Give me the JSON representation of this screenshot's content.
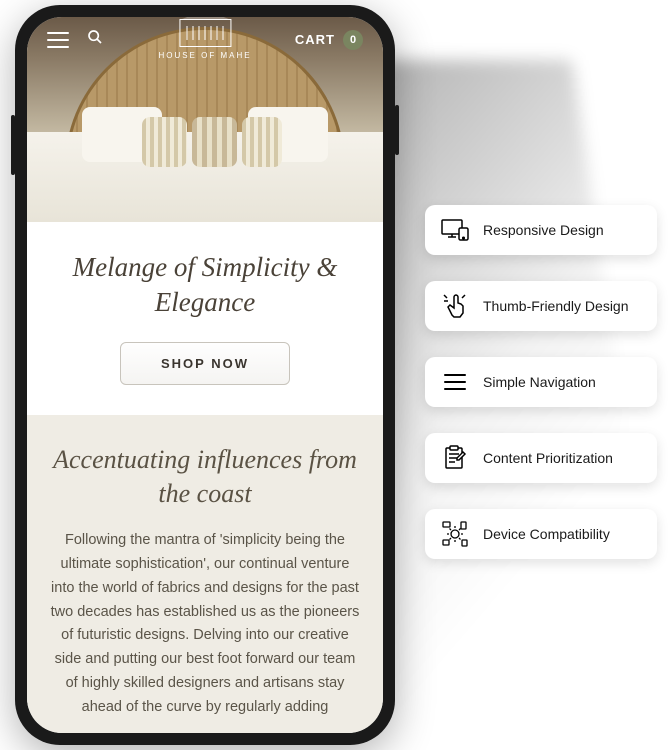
{
  "header": {
    "logo_text": "HOUSE OF MAHE",
    "cart_label": "CART",
    "cart_count": "0"
  },
  "hero": {
    "heading": "Melange of Simplicity & Elegance",
    "cta": "SHOP NOW"
  },
  "section2": {
    "heading": "Accentuating influences from the coast",
    "body": "Following the mantra of 'simplicity being the ultimate sophistication', our continual venture into the world of fabrics and designs for the past two decades has established us as the pioneers of futuristic designs. Delving into our creative side and putting our best foot forward our team of highly skilled designers and artisans stay ahead of the curve by regularly adding"
  },
  "features": [
    {
      "label": "Responsive Design",
      "icon": "devices"
    },
    {
      "label": "Thumb-Friendly Design",
      "icon": "thumb"
    },
    {
      "label": "Simple Navigation",
      "icon": "menu"
    },
    {
      "label": "Content Prioritization",
      "icon": "clipboard"
    },
    {
      "label": "Device Compatibility",
      "icon": "compat"
    }
  ],
  "colors": {
    "accent": "#7a8560",
    "beige": "#efece4",
    "text": "#4a4238"
  }
}
